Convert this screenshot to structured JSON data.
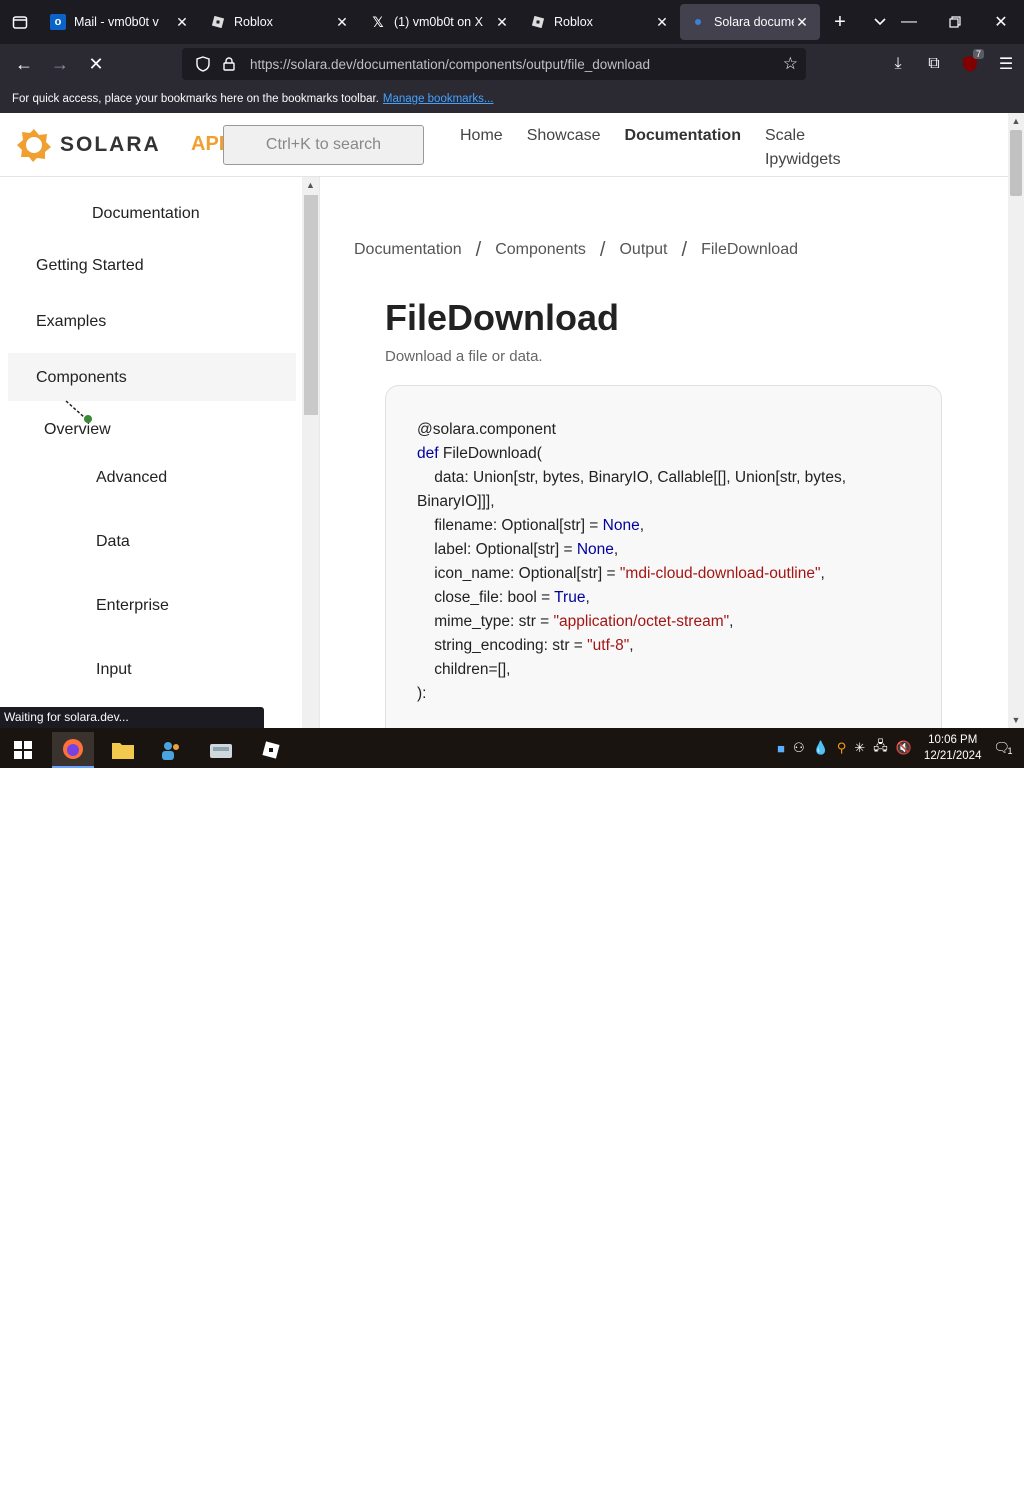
{
  "browser": {
    "tabs": [
      {
        "label": "Mail - vm0b0t v",
        "icon": "outlook-icon"
      },
      {
        "label": "Roblox",
        "icon": "roblox-icon"
      },
      {
        "label": "(1) vm0b0t on X",
        "icon": "x-icon"
      },
      {
        "label": "Roblox",
        "icon": "roblox-icon"
      },
      {
        "label": "Solara documer",
        "icon": "solara-icon",
        "active": true
      }
    ],
    "url": "https://solara.dev/documentation/components/output/file_download",
    "extension_badge": "7",
    "bookmarks_text": "For quick access, place your bookmarks here on the bookmarks toolbar.",
    "bookmarks_link": "Manage bookmarks...",
    "status": "Waiting for solara.dev..."
  },
  "site": {
    "logo_text": "SOLARA",
    "api_text": "API",
    "search_placeholder": "Ctrl+K to search",
    "nav": {
      "home": "Home",
      "showcase": "Showcase",
      "documentation": "Documentation",
      "scale": "Scale",
      "ipywidgets": "Ipywidgets"
    },
    "accent_color": "#f0a030"
  },
  "sidebar": {
    "title": "Documentation",
    "getting_started": "Getting Started",
    "examples": "Examples",
    "components": "Components",
    "overview": "Overview",
    "advanced": "Advanced",
    "data": "Data",
    "enterprise": "Enterprise",
    "input": "Input"
  },
  "main": {
    "breadcrumb": [
      "Documentation",
      "Components",
      "Output",
      "FileDownload"
    ],
    "title": "FileDownload",
    "subtitle": "Download a file or data.",
    "code": {
      "line1": "@solara.component",
      "def_kw": "def",
      "line2": " FileDownload(",
      "line3": "    data: Union[str, bytes, BinaryIO, Callable[[], Union[str, bytes, BinaryIO]]],",
      "filename_pre": "    filename: Optional[str] = ",
      "label_pre": "    label: Optional[str] = ",
      "none": "None",
      "icon_pre": "    icon_name: Optional[str] = ",
      "icon_val": "\"mdi-cloud-download-outline\"",
      "close_pre": "    close_file: bool = ",
      "true": "True",
      "mime_pre": "    mime_type: str = ",
      "mime_val": "\"application/octet-stream\"",
      "enc_pre": "    string_encoding: str = ",
      "enc_val": "\"utf-8\"",
      "children": "    children=[],",
      "close_paren": "):",
      "comma": ","
    }
  },
  "taskbar": {
    "time": "10:06 PM",
    "date": "12/21/2024",
    "notification_count": "1"
  }
}
